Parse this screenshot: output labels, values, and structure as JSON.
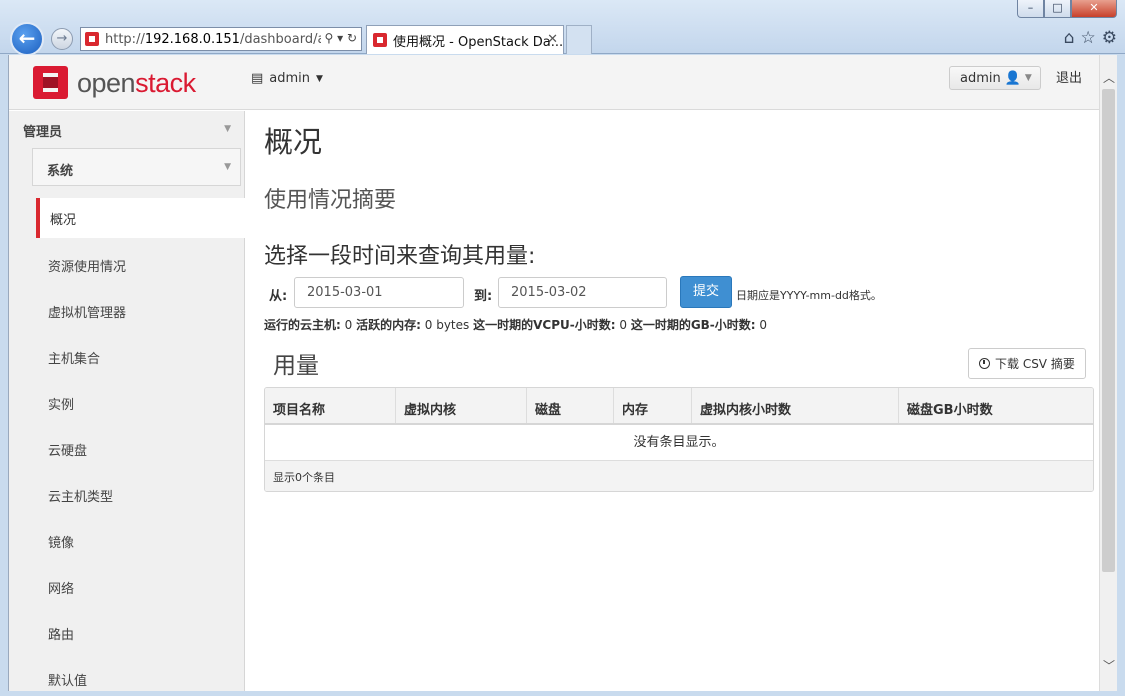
{
  "browser": {
    "window_buttons": {
      "minimize": "–",
      "maximize": "□",
      "close": "✕"
    },
    "address": {
      "prefix": "http://",
      "host": "192.168.0.151",
      "path": "/dashboard/ad",
      "tools": "⚲ ▾ ↻"
    },
    "tab_title": "使用概况 - OpenStack Da...",
    "tab_close": "✕",
    "icons": [
      "home-icon",
      "star-icon",
      "gear-icon"
    ]
  },
  "topbar": {
    "logo_part1": "open",
    "logo_part2": "stack",
    "project": "admin",
    "user": "admin",
    "signout": "退出"
  },
  "sidebar": {
    "group": "管理员",
    "subgroup": "系统",
    "items": [
      {
        "label": "概况",
        "active": true
      },
      {
        "label": "资源使用情况"
      },
      {
        "label": "虚拟机管理器"
      },
      {
        "label": "主机集合"
      },
      {
        "label": "实例"
      },
      {
        "label": "云硬盘"
      },
      {
        "label": "云主机类型"
      },
      {
        "label": "镜像"
      },
      {
        "label": "网络"
      },
      {
        "label": "路由"
      },
      {
        "label": "默认值"
      }
    ]
  },
  "main": {
    "title": "概况",
    "subtitle": "使用情况摘要",
    "query_heading": "选择一段时间来查询其用量:",
    "from_label": "从:",
    "from_value": "2015-03-01",
    "to_label": "到:",
    "to_value": "2015-03-02",
    "submit": "提交",
    "hint": "日期应是YYYY-mm-dd格式。",
    "stats": [
      {
        "label": "运行的云主机:",
        "value": "0"
      },
      {
        "label": "活跃的内存:",
        "value": "0 bytes"
      },
      {
        "label": "这一时期的VCPU-小时数:",
        "value": "0"
      },
      {
        "label": "这一时期的GB-小时数:",
        "value": "0"
      }
    ],
    "usage_heading": "用量",
    "csv_button": "下载 CSV 摘要",
    "table": {
      "headers": [
        "项目名称",
        "虚拟内核",
        "磁盘",
        "内存",
        "虚拟内核小时数",
        "磁盘GB小时数"
      ],
      "empty": "没有条目显示。",
      "footer": "显示0个条目"
    }
  },
  "colors": {
    "brand_red": "#da1a32",
    "primary_blue": "#3f8fd2"
  }
}
